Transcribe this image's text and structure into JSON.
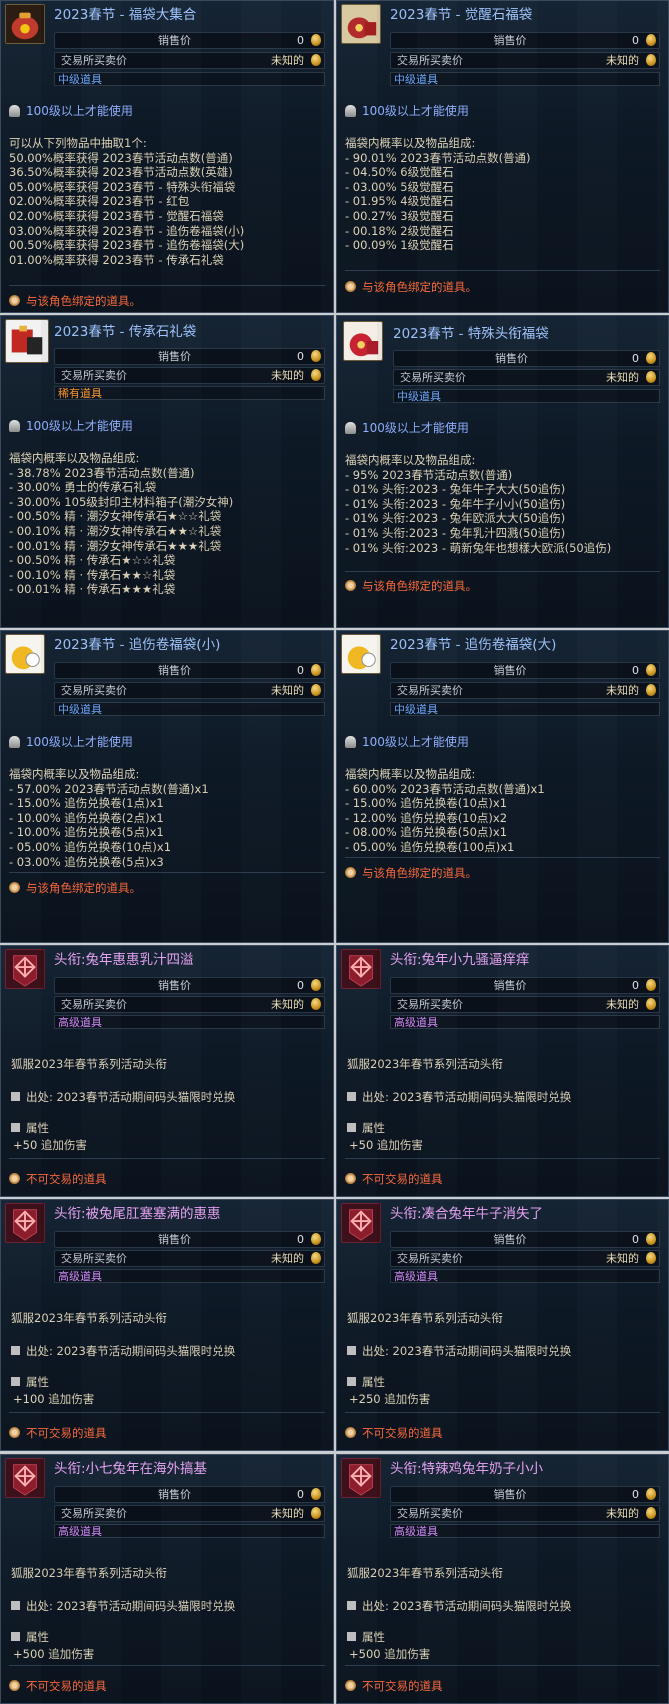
{
  "common": {
    "sell_label": "销售价",
    "trade_label": "交易所买卖价",
    "sell_value": "0",
    "trade_value": "未知的",
    "level_req": "100级以上才能使用",
    "bound_note": "与该角色绑定的道具。",
    "untradeable_note": "不可交易的道具",
    "headwear_desc": "狐服2023年春节系列活动头衔",
    "headwear_source": "出处: 2023春节活动期间码头猫限时兑换",
    "attr_label": "属性",
    "grade_mid": "中级道具",
    "grade_rare": "稀有道具",
    "grade_high": "高级道具"
  },
  "tooltips": [
    {
      "title": "2023春节 - 福袋大集合",
      "grade": "mid",
      "icon": "bag-icon",
      "lines": [
        "可以从下列物品中抽取1个:",
        "50.00%概率获得 2023春节活动点数(普通)",
        "36.50%概率获得 2023春节活动点数(英雄)",
        "05.00%概率获得 2023春节 - 特殊头衔福袋",
        "02.00%概率获得 2023春节 - 红包",
        "02.00%概率获得 2023春节 - 觉醒石福袋",
        "03.00%概率获得 2023春节 - 追伤卷福袋(小)",
        "00.50%概率获得 2023春节 - 追伤卷福袋(大)",
        "01.00%概率获得 2023春节 - 传承石礼袋"
      ]
    },
    {
      "title": "2023春节 - 觉醒石福袋",
      "grade": "mid",
      "icon": "awaken-bag-icon",
      "lines": [
        "福袋内概率以及物品组成:",
        "- 90.01% 2023春节活动点数(普通)",
        "- 04.50% 6级觉醒石",
        "- 03.00% 5级觉醒石",
        "- 01.95% 4级觉醒石",
        "- 00.27% 3级觉醒石",
        "- 00.18% 2级觉醒石",
        "- 00.09% 1级觉醒石"
      ]
    },
    {
      "title": "2023春节 - 传承石礼袋",
      "grade": "rare",
      "icon": "gift-bag-icon",
      "lines": [
        "福袋内概率以及物品组成:",
        "- 38.78% 2023春节活动点数(普通)",
        "- 30.00% 勇士的传承石礼袋",
        "- 30.00% 105级封印主材料箱子(潮汐女神)",
        "- 00.50% 精 · 潮汐女神传承石★☆☆礼袋",
        "- 00.10% 精 · 潮汐女神传承石★★☆礼袋",
        "- 00.01% 精 · 潮汐女神传承石★★★礼袋",
        "- 00.50% 精 · 传承石★☆☆礼袋",
        "- 00.10% 精 · 传承石★★☆礼袋",
        "- 00.01% 精 · 传承石★★★礼袋"
      ]
    },
    {
      "title": "2023春节 - 特殊头衔福袋",
      "grade": "mid",
      "icon": "title-bag-icon",
      "lines": [
        "福袋内概率以及物品组成:",
        "- 95% 2023春节活动点数(普通)",
        "- 01% 头衔:2023 - 兔年牛子大大(50追伤)",
        "- 01% 头衔:2023 - 兔年牛子小小(50追伤)",
        "- 01% 头衔:2023 - 兔年欧派大大(50追伤)",
        "- 01% 头衔:2023 - 兔年乳汁四溅(50追伤)",
        "- 01% 头衔:2023 - 萌新兔年也想樣大欧派(50追伤)"
      ]
    },
    {
      "title": "2023春节 - 追伤卷福袋(小)",
      "grade": "mid",
      "icon": "scroll-bag-small-icon",
      "lines": [
        "福袋内概率以及物品组成:",
        "- 57.00% 2023春节活动点数(普通)x1",
        "- 15.00% 追伤兑换卷(1点)x1",
        "- 10.00% 追伤兑换卷(2点)x1",
        "- 10.00% 追伤兑换卷(5点)x1",
        "- 05.00% 追伤兑换卷(10点)x1",
        "- 03.00% 追伤兑换卷(5点)x3"
      ]
    },
    {
      "title": "2023春节 - 追伤卷福袋(大)",
      "grade": "mid",
      "icon": "scroll-bag-large-icon",
      "lines": [
        "福袋内概率以及物品组成:",
        "- 60.00% 2023春节活动点数(普通)x1",
        "- 15.00% 追伤兑换卷(10点)x1",
        "- 12.00% 追伤兑换卷(10点)x2",
        "- 08.00% 追伤兑换卷(50点)x1",
        "- 05.00% 追伤兑换卷(100点)x1"
      ]
    },
    {
      "title": "头衔:兔年惠惠乳汁四溢",
      "grade": "high",
      "icon": "knot-icon",
      "attr": "+50 追加伤害"
    },
    {
      "title": "头衔:兔年小九骚逼痒痒",
      "grade": "high",
      "icon": "knot-icon",
      "attr": "+50 追加伤害"
    },
    {
      "title": "头衔:被兔尾肛塞塞满的惠惠",
      "grade": "high",
      "icon": "knot-icon",
      "attr": "+100 追加伤害"
    },
    {
      "title": "头衔:凑合兔年牛子消失了",
      "grade": "high",
      "icon": "knot-icon",
      "attr": "+250 追加伤害"
    },
    {
      "title": "头衔:小七兔年在海外搞基",
      "grade": "high",
      "icon": "knot-icon",
      "attr": "+500 追加伤害"
    },
    {
      "title": "头衔:特辣鸡兔年奶子小小",
      "grade": "high",
      "icon": "knot-icon",
      "attr": "+500 追加伤害"
    }
  ]
}
